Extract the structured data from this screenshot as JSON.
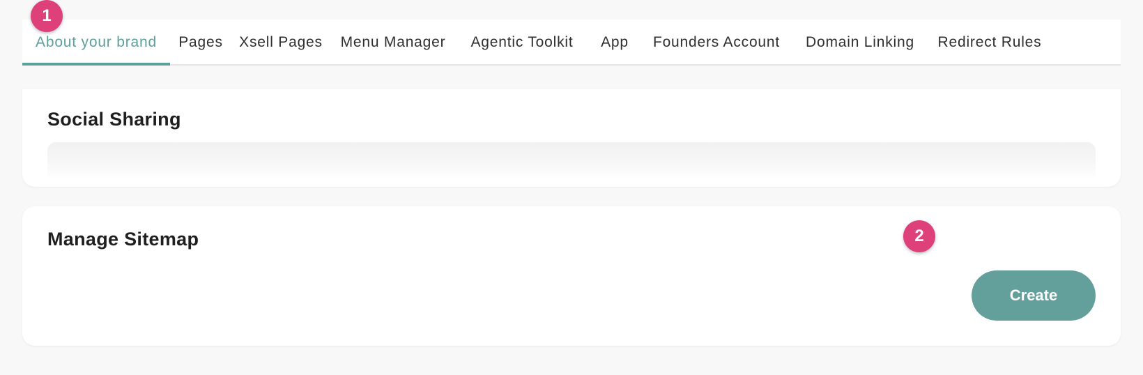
{
  "tabs": [
    {
      "label": "About your brand",
      "active": true
    },
    {
      "label": "Pages",
      "active": false
    },
    {
      "label": "Xsell Pages",
      "active": false
    },
    {
      "label": "Menu Manager",
      "active": false
    },
    {
      "label": "Agentic Toolkit",
      "active": false
    },
    {
      "label": "App",
      "active": false
    },
    {
      "label": "Founders Account",
      "active": false
    },
    {
      "label": "Domain Linking",
      "active": false
    },
    {
      "label": "Redirect Rules",
      "active": false
    }
  ],
  "badges": {
    "step1": "1",
    "step2": "2"
  },
  "social_sharing": {
    "title": "Social Sharing"
  },
  "manage_sitemap": {
    "title": "Manage Sitemap",
    "create_label": "Create"
  },
  "colors": {
    "accent": "#5d9f9a",
    "button": "#64a09b",
    "badge": "#de407a",
    "background": "#f8f8f8"
  }
}
